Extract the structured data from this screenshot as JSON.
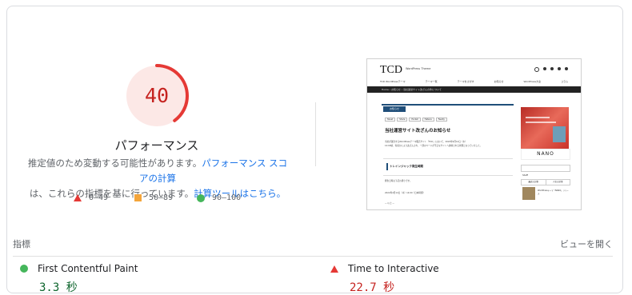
{
  "gauge": {
    "score": "40",
    "score_fraction": 0.4,
    "title": "パフォーマンス",
    "color": "#c5221f",
    "bg_color": "#fce8e6"
  },
  "description": {
    "line1_prefix": "推定値のため変動する可能性があります。",
    "line1_link": "パフォーマンス スコアの計算",
    "line2_prefix": "は、これらの指標を基に行っています。",
    "line2_link": "計算ツールはこちら。"
  },
  "legend": [
    {
      "range": "0–49",
      "icon": "red-triangle-icon",
      "color": "#e53935"
    },
    {
      "range": "50–89",
      "icon": "orange-square-icon",
      "color": "#f4a53b"
    },
    {
      "range": "90–100",
      "icon": "green-circle-icon",
      "color": "#45b65b"
    }
  ],
  "screenshot": {
    "logo": "TCD",
    "logo_sub": "WordPress Theme",
    "nav_items": [
      "TCD WordPressテーマ",
      "テーマ一覧",
      "テーマをさがす",
      "お知らせ",
      "WordPress大全",
      "コラム"
    ],
    "breadcrumb": "Home › お知らせ › 当社運営サイト改ざんの件について",
    "tag": "お知らせ",
    "share": [
      "Tweet",
      "Share",
      "Pocket",
      "Hatena",
      "Feedly"
    ],
    "article_title": "当社運営サイト改ざんのお知らせ",
    "body_lines": [
      "当社が運営するWordPressテーマ販売サイト「TCD」において、2022年4月14日（木）",
      "14:00頃、何者かにより改ざんされ、一部のページが不正なサイトへ誘導される状態となっていました。"
    ],
    "subheading": "トレインジャック発生時期",
    "body2": "発生日時は下記の通りです。",
    "body3": "2022年4月14日（木）14:00（日本時間）",
    "body4": "— 以上 —",
    "ad_text": "NANO",
    "side_heading": "Staff",
    "side_tabs": [
      "最近の記事",
      "人気の記事"
    ],
    "side_item": "WordPressテーマ「NANO」リリース"
  },
  "metrics_section": {
    "label": "指標",
    "toggle": "ビューを開く"
  },
  "metrics": [
    {
      "name": "First Contentful Paint",
      "value": "3.3 秒",
      "status": "good"
    },
    {
      "name": "Time to Interactive",
      "value": "22.7 秒",
      "status": "poor"
    }
  ]
}
